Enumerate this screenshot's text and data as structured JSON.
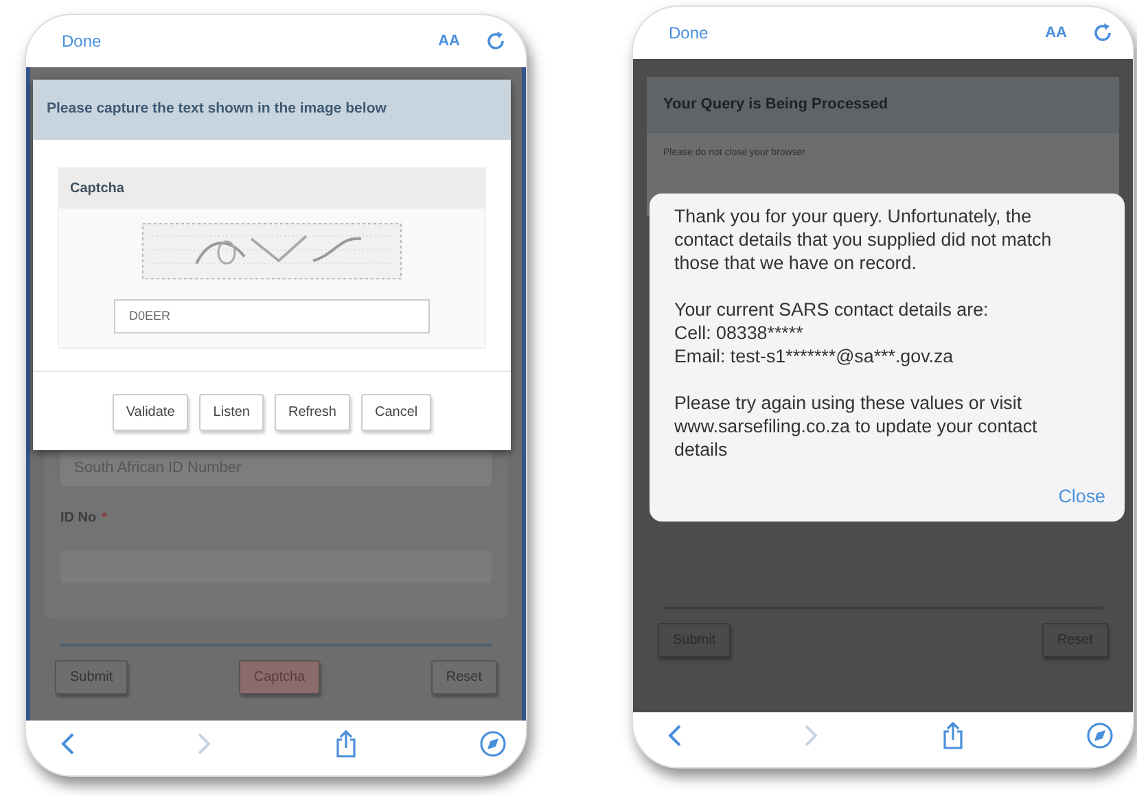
{
  "phones": [
    {
      "kind": "captcha",
      "top_bar": {
        "done": "Done",
        "text_size": "AA"
      },
      "page": {
        "select": "South African ID Number",
        "field_label": "ID No",
        "required_mark": "*",
        "buttons": [
          {
            "label": "Submit",
            "kind": "default"
          },
          {
            "label": "Captcha",
            "kind": "accent"
          },
          {
            "label": "Reset",
            "kind": "default"
          }
        ]
      },
      "dialog": {
        "title": "Please capture the text shown in the image below",
        "panel_title": "Captcha",
        "input_value": "D0EER",
        "buttons": [
          "Validate",
          "Listen",
          "Refresh",
          "Cancel"
        ]
      }
    },
    {
      "kind": "alert",
      "top_bar": {
        "done": "Done",
        "text_size": "AA"
      },
      "page": {
        "header": "Your Query is Being Processed",
        "note": "Please do not close your browser",
        "buttons": [
          {
            "label": "Submit",
            "kind": "default"
          },
          {
            "label": "Reset",
            "kind": "default"
          }
        ]
      },
      "dialog": {
        "paragraphs": [
          [
            "Thank you for your query. Unfortunately, the contact details that you supplied did not match those that we have on record."
          ],
          [
            "Your current SARS contact details are:",
            "Cell: 08338*****",
            "Email: test-s1*******@sa***.gov.za"
          ],
          [
            "Please try again using these values or visit www.sarsefiling.co.za to update your contact details"
          ]
        ],
        "close": "Close"
      }
    }
  ]
}
